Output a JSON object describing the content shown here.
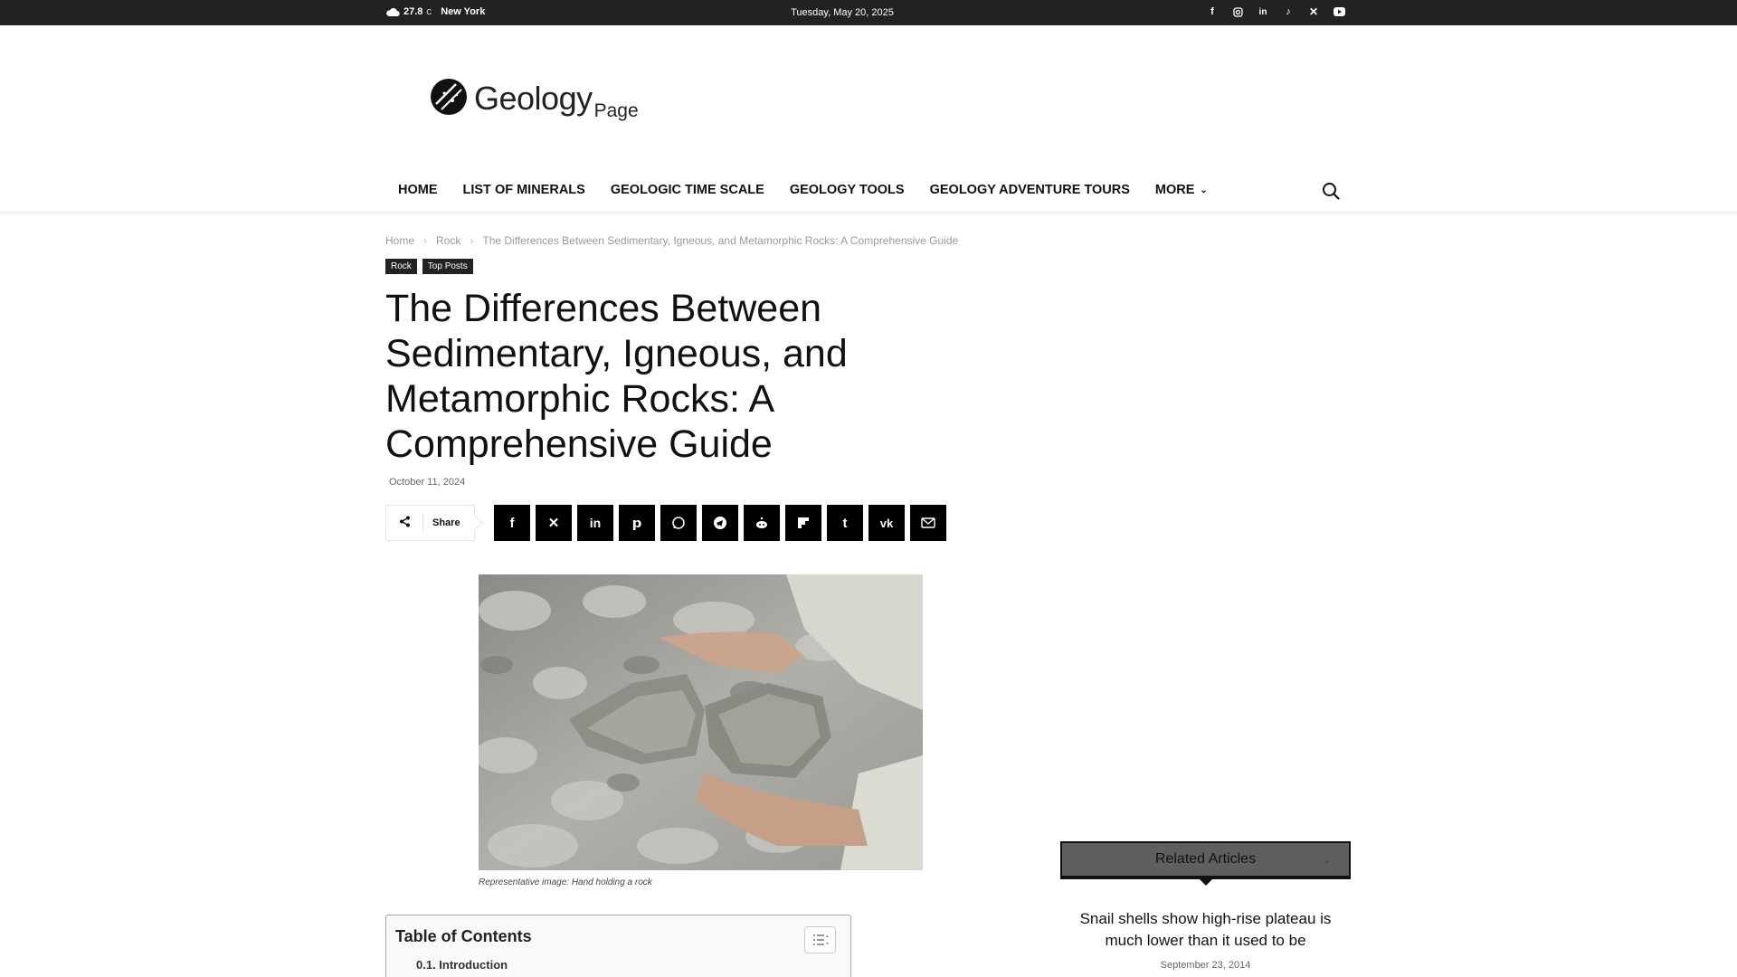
{
  "topbar": {
    "temperature": "27.8",
    "degree_unit": "C",
    "city": "New York",
    "date": "Tuesday, May 20, 2025",
    "socials": [
      "facebook",
      "instagram",
      "linkedin",
      "tiktok",
      "x",
      "youtube"
    ]
  },
  "logo": {
    "main": "Geology",
    "sub": "Page"
  },
  "nav": {
    "items": [
      "HOME",
      "LIST OF MINERALS",
      "GEOLOGIC TIME SCALE",
      "GEOLOGY TOOLS",
      "GEOLOGY ADVENTURE TOURS",
      "MORE"
    ]
  },
  "breadcrumb": {
    "home": "Home",
    "category": "Rock",
    "current": "The Differences Between Sedimentary, Igneous, and Metamorphic Rocks: A Comprehensive Guide"
  },
  "tags": [
    "Rock",
    "Top Posts"
  ],
  "article": {
    "title": "The Differences Between Sedimentary, Igneous, and Metamorphic Rocks: A Comprehensive Guide",
    "date": "October 11, 2024",
    "caption": "Representative image: Hand holding a rock"
  },
  "share": {
    "label": "Share",
    "buttons": [
      "facebook",
      "x",
      "linkedin",
      "pinterest",
      "whatsapp",
      "telegram",
      "reddit",
      "flipboard",
      "tumblr",
      "vk",
      "email"
    ]
  },
  "toc": {
    "title": "Table of Contents",
    "items": [
      "0.1. Introduction"
    ]
  },
  "related": {
    "heading": "Related Articles",
    "article_title": "Snail shells show high-rise plateau is much lower than it used to be",
    "article_date": "September 23, 2014"
  }
}
